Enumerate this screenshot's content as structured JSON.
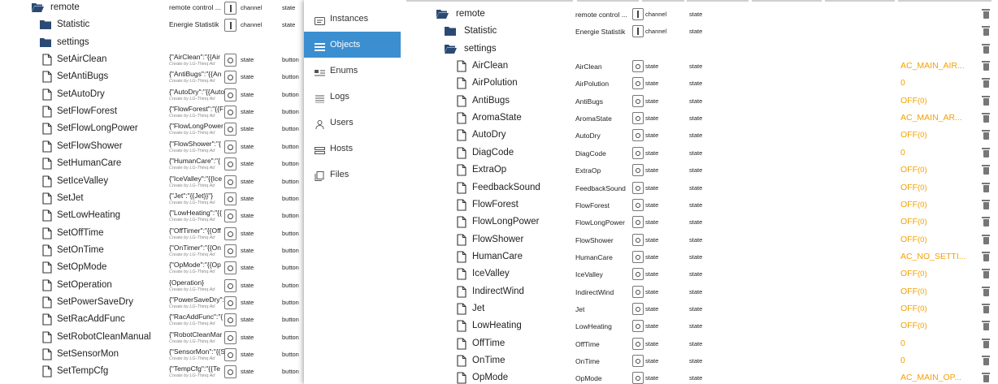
{
  "left_tree": {
    "rows": [
      {
        "name": "remote",
        "kind": "folder-open",
        "depth": 0,
        "value": "remote control ...",
        "value_sub": "",
        "type": "channel",
        "role": "state",
        "write": ""
      },
      {
        "name": "Statistic",
        "kind": "folder",
        "depth": 1,
        "value": "Energie Statistik",
        "value_sub": "",
        "type": "channel",
        "role": "state",
        "write": ""
      },
      {
        "name": "settings",
        "kind": "folder",
        "depth": 1,
        "value": "",
        "value_sub": "",
        "type": "",
        "role": "",
        "write": ""
      },
      {
        "name": "SetAirClean",
        "kind": "file",
        "depth": 1,
        "value": "{\"AirClean\":\"{{Air",
        "value_sub": "Create by LG-Thinq Ad",
        "type": "state",
        "role": "state",
        "write": "button"
      },
      {
        "name": "SetAntiBugs",
        "kind": "file",
        "depth": 1,
        "value": "{\"AntiBugs\":\"{{An",
        "value_sub": "Create by LG-Thinq Ad",
        "type": "state",
        "role": "state",
        "write": "button"
      },
      {
        "name": "SetAutoDry",
        "kind": "file",
        "depth": 1,
        "value": "{\"AutoDry\":\"{{Auto",
        "value_sub": "Create by LG-Thinq Ad",
        "type": "state",
        "role": "state",
        "write": "button"
      },
      {
        "name": "SetFlowForest",
        "kind": "file",
        "depth": 1,
        "value": "{\"FlowForest\":\"{{F",
        "value_sub": "Create by LG-Thinq Ad",
        "type": "state",
        "role": "state",
        "write": "button"
      },
      {
        "name": "SetFlowLongPower",
        "kind": "file",
        "depth": 1,
        "value": "{\"FlowLongPower",
        "value_sub": "Create by LG-Thinq Ad",
        "type": "state",
        "role": "state",
        "write": "button"
      },
      {
        "name": "SetFlowShower",
        "kind": "file",
        "depth": 1,
        "value": "{\"FlowShower\":\"{",
        "value_sub": "Create by LG-Thinq Ad",
        "type": "state",
        "role": "state",
        "write": "button"
      },
      {
        "name": "SetHumanCare",
        "kind": "file",
        "depth": 1,
        "value": "{\"HumanCare\":\"{",
        "value_sub": "Create by LG-Thinq Ad",
        "type": "state",
        "role": "state",
        "write": "button"
      },
      {
        "name": "SetIceValley",
        "kind": "file",
        "depth": 1,
        "value": "{\"IceValley\":\"{{Ice",
        "value_sub": "Create by LG-Thinq Ad",
        "type": "state",
        "role": "state",
        "write": "button"
      },
      {
        "name": "SetJet",
        "kind": "file",
        "depth": 1,
        "value": "{\"Jet\":\"{{Jet}}\"}",
        "value_sub": "Create by LG-Thinq Ad",
        "type": "state",
        "role": "state",
        "write": "button"
      },
      {
        "name": "SetLowHeating",
        "kind": "file",
        "depth": 1,
        "value": "{\"LowHeating\":\"{{",
        "value_sub": "Create by LG-Thinq Ad",
        "type": "state",
        "role": "state",
        "write": "button"
      },
      {
        "name": "SetOffTime",
        "kind": "file",
        "depth": 1,
        "value": "{\"OffTimer\":\"{{Off",
        "value_sub": "Create by LG-Thinq Ad",
        "type": "state",
        "role": "state",
        "write": "button"
      },
      {
        "name": "SetOnTime",
        "kind": "file",
        "depth": 1,
        "value": "{\"OnTimer\":\"{{On",
        "value_sub": "Create by LG-Thinq Ad",
        "type": "state",
        "role": "state",
        "write": "button"
      },
      {
        "name": "SetOpMode",
        "kind": "file",
        "depth": 1,
        "value": "{\"OpMode\":\"{{Op",
        "value_sub": "Create by LG-Thinq Ad",
        "type": "state",
        "role": "state",
        "write": "button"
      },
      {
        "name": "SetOperation",
        "kind": "file",
        "depth": 1,
        "value": "{Operation}",
        "value_sub": "Create by LG-Thinq Ad",
        "type": "state",
        "role": "state",
        "write": "button"
      },
      {
        "name": "SetPowerSaveDry",
        "kind": "file",
        "depth": 1,
        "value": "{\"PowerSaveDry\":",
        "value_sub": "Create by LG-Thinq Ad",
        "type": "state",
        "role": "state",
        "write": "button"
      },
      {
        "name": "SetRacAddFunc",
        "kind": "file",
        "depth": 1,
        "value": "{\"RacAddFunc\":\"{",
        "value_sub": "Create by LG-Thinq Ad",
        "type": "state",
        "role": "state",
        "write": "button"
      },
      {
        "name": "SetRobotCleanManual",
        "kind": "file",
        "depth": 1,
        "value": "{\"RobotCleanMar",
        "value_sub": "Create by LG-Thinq Ad",
        "type": "state",
        "role": "state",
        "write": "button"
      },
      {
        "name": "SetSensorMon",
        "kind": "file",
        "depth": 1,
        "value": "{\"SensorMon\":\"{{S",
        "value_sub": "Create by LG-Thinq Ad",
        "type": "state",
        "role": "state",
        "write": "button"
      },
      {
        "name": "SetTempCfg",
        "kind": "file",
        "depth": 1,
        "value": "{\"TempCfg\":\"{{Te",
        "value_sub": "Create by LG-Thinq Ad",
        "type": "state",
        "role": "state",
        "write": "button"
      }
    ]
  },
  "menu": {
    "items": [
      {
        "label": "Instances",
        "icon": "instances-icon",
        "active": false
      },
      {
        "label": "Objects",
        "icon": "objects-icon",
        "active": true
      },
      {
        "label": "Enums",
        "icon": "enums-icon",
        "active": false
      },
      {
        "label": "Logs",
        "icon": "logs-icon",
        "active": false
      },
      {
        "label": "Users",
        "icon": "users-icon",
        "active": false
      },
      {
        "label": "Hosts",
        "icon": "hosts-icon",
        "active": false
      },
      {
        "label": "Files",
        "icon": "files-icon",
        "active": false
      }
    ],
    "active_color": "#3b8ed0"
  },
  "right_tree": {
    "value_color": "#f5a000",
    "rows": [
      {
        "name": "remote",
        "kind": "folder-open",
        "depth": 0,
        "common_name": "remote control ...",
        "type": "channel",
        "role": "state",
        "value": "",
        "ack": ""
      },
      {
        "name": "Statistic",
        "kind": "folder",
        "depth": 1,
        "common_name": "Energie Statistik",
        "type": "channel",
        "role": "state",
        "value": "",
        "ack": ""
      },
      {
        "name": "settings",
        "kind": "folder-open",
        "depth": 1,
        "common_name": "",
        "type": "",
        "role": "",
        "value": "",
        "ack": ""
      },
      {
        "name": "AirClean",
        "kind": "file",
        "depth": 2,
        "common_name": "AirClean",
        "type": "state",
        "role": "state",
        "value": "AC_MAIN_AIR...",
        "ack": ""
      },
      {
        "name": "AirPolution",
        "kind": "file",
        "depth": 2,
        "common_name": "AirPolution",
        "type": "state",
        "role": "state",
        "value": "0",
        "ack": ""
      },
      {
        "name": "AntiBugs",
        "kind": "file",
        "depth": 2,
        "common_name": "AntiBugs",
        "type": "state",
        "role": "state",
        "value": "OFF",
        "ack": "(0)"
      },
      {
        "name": "AromaState",
        "kind": "file",
        "depth": 2,
        "common_name": "AromaState",
        "type": "state",
        "role": "state",
        "value": "AC_MAIN_AR...",
        "ack": ""
      },
      {
        "name": "AutoDry",
        "kind": "file",
        "depth": 2,
        "common_name": "AutoDry",
        "type": "state",
        "role": "state",
        "value": "OFF",
        "ack": "(0)"
      },
      {
        "name": "DiagCode",
        "kind": "file",
        "depth": 2,
        "common_name": "DiagCode",
        "type": "state",
        "role": "state",
        "value": "0",
        "ack": ""
      },
      {
        "name": "ExtraOp",
        "kind": "file",
        "depth": 2,
        "common_name": "ExtraOp",
        "type": "state",
        "role": "state",
        "value": "OFF",
        "ack": "(0)"
      },
      {
        "name": "FeedbackSound",
        "kind": "file",
        "depth": 2,
        "common_name": "FeedbackSound",
        "type": "state",
        "role": "state",
        "value": "OFF",
        "ack": "(0)"
      },
      {
        "name": "FlowForest",
        "kind": "file",
        "depth": 2,
        "common_name": "FlowForest",
        "type": "state",
        "role": "state",
        "value": "OFF",
        "ack": "(0)"
      },
      {
        "name": "FlowLongPower",
        "kind": "file",
        "depth": 2,
        "common_name": "FlowLongPower",
        "type": "state",
        "role": "state",
        "value": "OFF",
        "ack": "(0)"
      },
      {
        "name": "FlowShower",
        "kind": "file",
        "depth": 2,
        "common_name": "FlowShower",
        "type": "state",
        "role": "state",
        "value": "OFF",
        "ack": "(0)"
      },
      {
        "name": "HumanCare",
        "kind": "file",
        "depth": 2,
        "common_name": "HumanCare",
        "type": "state",
        "role": "state",
        "value": "AC_NO_SETTI...",
        "ack": ""
      },
      {
        "name": "IceValley",
        "kind": "file",
        "depth": 2,
        "common_name": "IceValley",
        "type": "state",
        "role": "state",
        "value": "OFF",
        "ack": "(0)"
      },
      {
        "name": "IndirectWind",
        "kind": "file",
        "depth": 2,
        "common_name": "IndirectWind",
        "type": "state",
        "role": "state",
        "value": "OFF",
        "ack": "(0)"
      },
      {
        "name": "Jet",
        "kind": "file",
        "depth": 2,
        "common_name": "Jet",
        "type": "state",
        "role": "state",
        "value": "OFF",
        "ack": "(0)"
      },
      {
        "name": "LowHeating",
        "kind": "file",
        "depth": 2,
        "common_name": "LowHeating",
        "type": "state",
        "role": "state",
        "value": "OFF",
        "ack": "(0)"
      },
      {
        "name": "OffTime",
        "kind": "file",
        "depth": 2,
        "common_name": "OffTime",
        "type": "state",
        "role": "state",
        "value": "0",
        "ack": ""
      },
      {
        "name": "OnTime",
        "kind": "file",
        "depth": 2,
        "common_name": "OnTime",
        "type": "state",
        "role": "state",
        "value": "0",
        "ack": ""
      },
      {
        "name": "OpMode",
        "kind": "file",
        "depth": 2,
        "common_name": "OpMode",
        "type": "state",
        "role": "state",
        "value": "AC_MAIN_OP...",
        "ack": ""
      }
    ]
  }
}
